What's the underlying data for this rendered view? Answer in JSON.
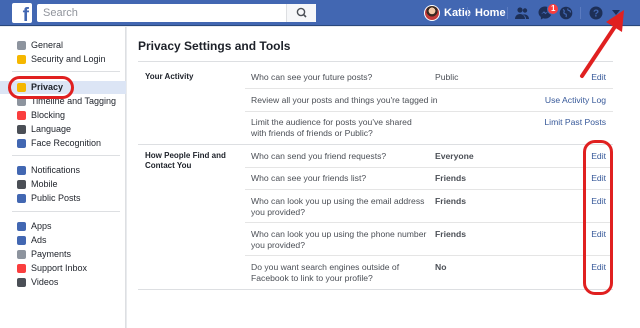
{
  "topbar": {
    "logo": "f",
    "search_placeholder": "Search",
    "user_name": "Katie",
    "home_label": "Home",
    "notification_count": "1",
    "icons": [
      "friends-icon",
      "messenger-icon",
      "globe-icon",
      "help-icon",
      "caret-down-icon"
    ],
    "colors": {
      "bar": "#4267b2",
      "badge": "#fa3e3e"
    }
  },
  "sidebar": {
    "items": [
      {
        "label": "General",
        "icon": "gear-icon",
        "color": "#8d949e"
      },
      {
        "label": "Security and Login",
        "icon": "shield-icon",
        "color": "#f5b700"
      },
      {
        "label": "Privacy",
        "icon": "lock-icon",
        "color": "#f5b700",
        "active": true
      },
      {
        "label": "Timeline and Tagging",
        "icon": "timeline-icon",
        "color": "#8d949e"
      },
      {
        "label": "Blocking",
        "icon": "block-icon",
        "color": "#fa3e3e"
      },
      {
        "label": "Language",
        "icon": "language-icon",
        "color": "#4b4f56"
      },
      {
        "label": "Face Recognition",
        "icon": "face-icon",
        "color": "#4267b2"
      },
      {
        "label": "Notifications",
        "icon": "globe-icon",
        "color": "#4267b2"
      },
      {
        "label": "Mobile",
        "icon": "mobile-icon",
        "color": "#4b4f56"
      },
      {
        "label": "Public Posts",
        "icon": "rss-icon",
        "color": "#4267b2"
      },
      {
        "label": "Apps",
        "icon": "apps-icon",
        "color": "#4267b2"
      },
      {
        "label": "Ads",
        "icon": "ads-icon",
        "color": "#4267b2"
      },
      {
        "label": "Payments",
        "icon": "payments-icon",
        "color": "#8d949e"
      },
      {
        "label": "Support Inbox",
        "icon": "support-icon",
        "color": "#fa3e3e"
      },
      {
        "label": "Videos",
        "icon": "videos-icon",
        "color": "#4b4f56"
      }
    ]
  },
  "main": {
    "title": "Privacy Settings and Tools",
    "sections": [
      {
        "label": "Your Activity",
        "rows": [
          {
            "question": "Who can see your future posts?",
            "value": "Public",
            "action": "Edit"
          },
          {
            "question": "Review all your posts and things you're tagged in",
            "value": "",
            "action": "Use Activity Log"
          },
          {
            "question": "Limit the audience for posts you've shared with friends of friends or Public?",
            "value": "",
            "action": "Limit Past Posts"
          }
        ]
      },
      {
        "label": "How People Find and Contact You",
        "rows": [
          {
            "question": "Who can send you friend requests?",
            "value": "Everyone",
            "action": "Edit"
          },
          {
            "question": "Who can see your friends list?",
            "value": "Friends",
            "action": "Edit"
          },
          {
            "question": "Who can look you up using the email address you provided?",
            "value": "Friends",
            "action": "Edit"
          },
          {
            "question": "Who can look you up using the phone number you provided?",
            "value": "Friends",
            "action": "Edit"
          },
          {
            "question": "Do you want search engines outside of Facebook to link to your profile?",
            "value": "No",
            "action": "Edit"
          }
        ]
      }
    ]
  },
  "annotation": {
    "color": "#e02020"
  }
}
